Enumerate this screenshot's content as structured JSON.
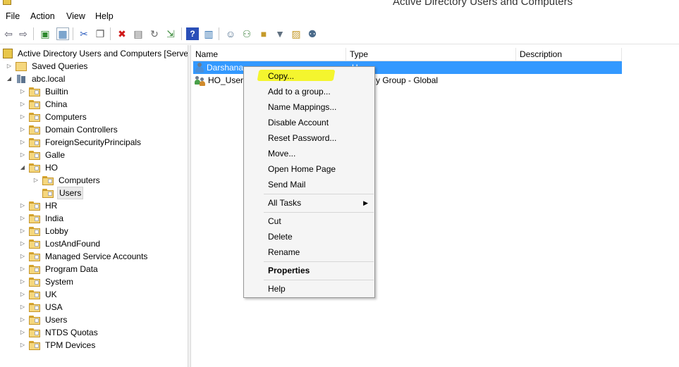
{
  "window": {
    "title": "Active Directory Users and Computers"
  },
  "menu": [
    "File",
    "Action",
    "View",
    "Help"
  ],
  "toolbar": {
    "icons": [
      "back-arrow-icon",
      "forward-arrow-icon",
      "up-folder-icon",
      "show-console-tree-icon",
      "cut-icon",
      "copy-icon",
      "delete-icon",
      "properties-icon",
      "refresh-icon",
      "export-list-icon",
      "help-icon",
      "show-hide-action-pane-icon",
      "new-user-icon",
      "new-group-icon",
      "new-ou-icon",
      "filter-icon",
      "find-icon",
      "add-to-group-icon"
    ]
  },
  "tree": {
    "root": "Active Directory Users and Computers [Server",
    "saved_queries": "Saved Queries",
    "domain": "abc.local",
    "ous": [
      "Builtin",
      "China",
      "Computers",
      "Domain Controllers",
      "ForeignSecurityPrincipals",
      "Galle",
      "HO"
    ],
    "ho_children": [
      "Computers",
      "Users"
    ],
    "ous_after": [
      "HR",
      "India",
      "Lobby",
      "LostAndFound",
      "Managed Service Accounts",
      "Program Data",
      "System",
      "UK",
      "USA",
      "Users",
      "NTDS Quotas",
      "TPM Devices"
    ]
  },
  "list": {
    "columns": [
      "Name",
      "Type",
      "Description"
    ],
    "rows": [
      {
        "name": "Darshana",
        "type": "U",
        "description": ""
      },
      {
        "name": "HO_Users",
        "type": "y Group - Global",
        "description": ""
      }
    ]
  },
  "context_menu": {
    "items": [
      "Copy...",
      "Add to a group...",
      "Name Mappings...",
      "Disable Account",
      "Reset Password...",
      "Move...",
      "Open Home Page",
      "Send Mail",
      "All Tasks",
      "Cut",
      "Delete",
      "Rename",
      "Properties",
      "Help"
    ],
    "highlight_color": "#f4f52e"
  },
  "colors": {
    "selection": "#3399ff"
  }
}
